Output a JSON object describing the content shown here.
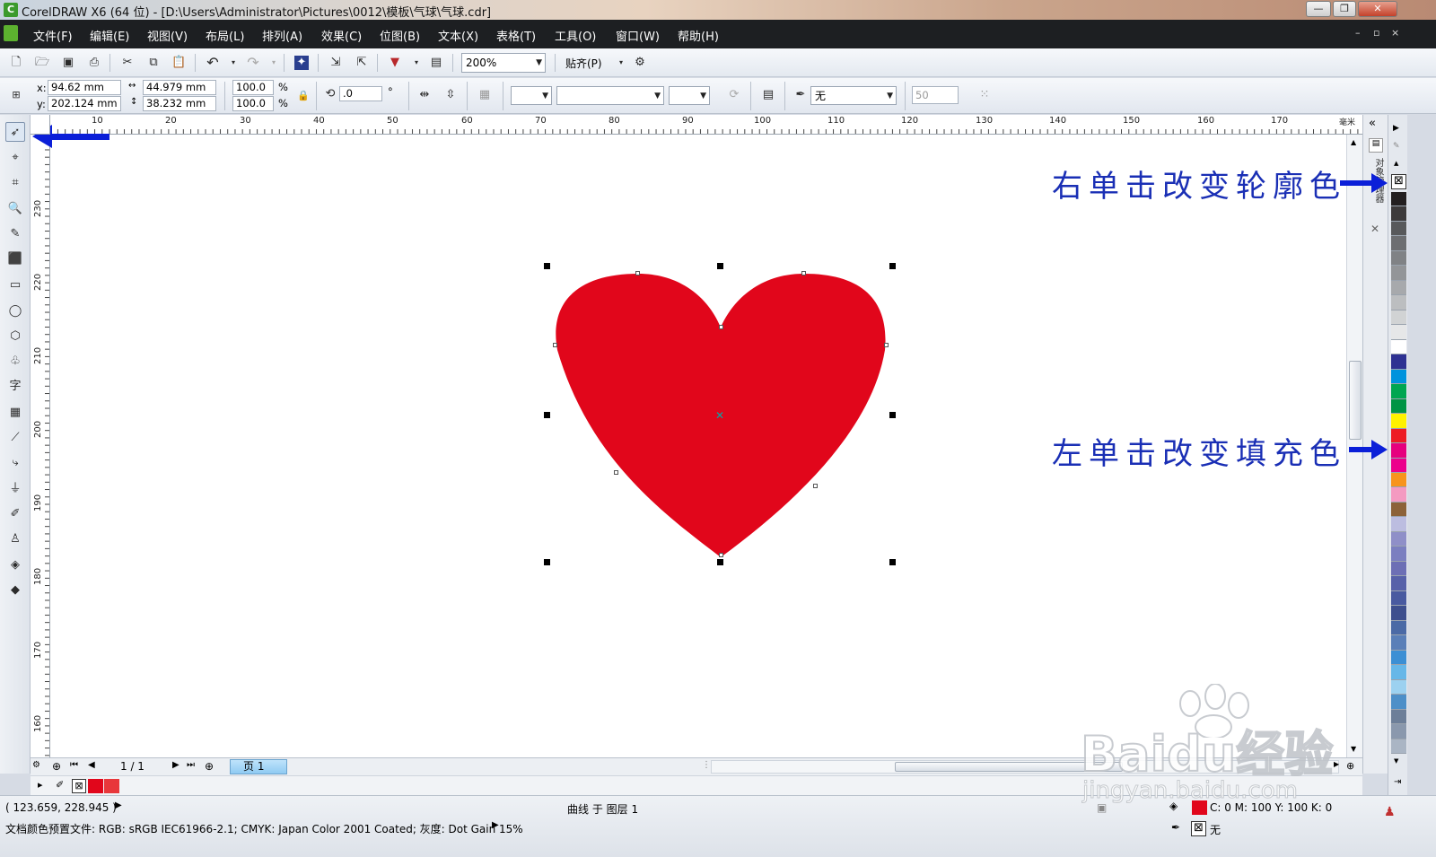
{
  "window": {
    "title": "CorelDRAW X6 (64 位) - [D:\\Users\\Administrator\\Pictures\\0012\\模板\\气球\\气球.cdr]",
    "min_glyph": "—",
    "max_glyph": "❐",
    "close_glyph": "✕"
  },
  "menu": {
    "items": [
      "文件(F)",
      "编辑(E)",
      "视图(V)",
      "布局(L)",
      "排列(A)",
      "效果(C)",
      "位图(B)",
      "文本(X)",
      "表格(T)",
      "工具(O)",
      "窗口(W)",
      "帮助(H)"
    ],
    "mdi": [
      "–",
      "▫",
      "×"
    ]
  },
  "toolbar": {
    "zoom": "200%",
    "snap_label": "贴齐(P)"
  },
  "propbar": {
    "x_label": "x:",
    "x_value": "94.62 mm",
    "y_label": "y:",
    "y_value": "202.124 mm",
    "w_value": "44.979 mm",
    "h_value": "38.232 mm",
    "scale_x": "100.0",
    "scale_y": "100.0",
    "pct": "%",
    "rotate": ".0",
    "deg": "°",
    "outline_width": "无",
    "miter": "50"
  },
  "ruler": {
    "h_labels": [
      "10",
      "20",
      "30",
      "40",
      "50",
      "60",
      "70",
      "80",
      "90",
      "100",
      "110",
      "120",
      "130",
      "140",
      "150",
      "160",
      "170"
    ],
    "h_unit": "毫米",
    "v_labels": [
      "230",
      "220",
      "210",
      "200",
      "190",
      "180",
      "170",
      "160"
    ],
    "v_unit": "毫米"
  },
  "pagebar": {
    "page_count": "1 / 1",
    "page_tab": "页 1"
  },
  "status": {
    "coords": "( 123.659, 228.945 )",
    "object_info": "曲线 于 图层 1",
    "fill_info": "C: 0 M: 100 Y: 100 K: 0",
    "outline_info": "无",
    "color_profile": "文档颜色预置文件: RGB: sRGB IEC61966-2.1; CMYK: Japan Color 2001 Coated; 灰度: Dot Gain 15%"
  },
  "docker": {
    "tab_label": "对象管理器"
  },
  "annotations": {
    "right_click": "右单击改变轮廓色",
    "left_click": "左单击改变填充色"
  },
  "watermark": {
    "line1": "Baidu经验",
    "line2": "jingyan.baidu.com"
  },
  "colors": {
    "heart_fill": "#e1061b",
    "annotation": "#1a2fb5",
    "arrow": "#0b1fd8",
    "palette": [
      "#231f20",
      "#3d3a3b",
      "#58595b",
      "#6d6e71",
      "#808285",
      "#939598",
      "#a7a9ac",
      "#bcbec0",
      "#d1d3d4",
      "#e6e7e8",
      "#ffffff",
      "#2e3192",
      "#0093dd",
      "#00a651",
      "#009444",
      "#fff200",
      "#ed1c24",
      "#e6007e",
      "#ec008c",
      "#f7941d",
      "#f49ac1",
      "#8c6239",
      "#bcbde0",
      "#8f8fc8",
      "#7b7fc0",
      "#6d6fb5",
      "#5761a9",
      "#495aa0",
      "#3e4f8e",
      "#4b6aa6",
      "#5a7fb8",
      "#3c8fd4",
      "#67b7e8",
      "#9cd1f0",
      "#4d8fc8",
      "#6d7f99",
      "#8a98ad",
      "#aab5c4"
    ]
  }
}
